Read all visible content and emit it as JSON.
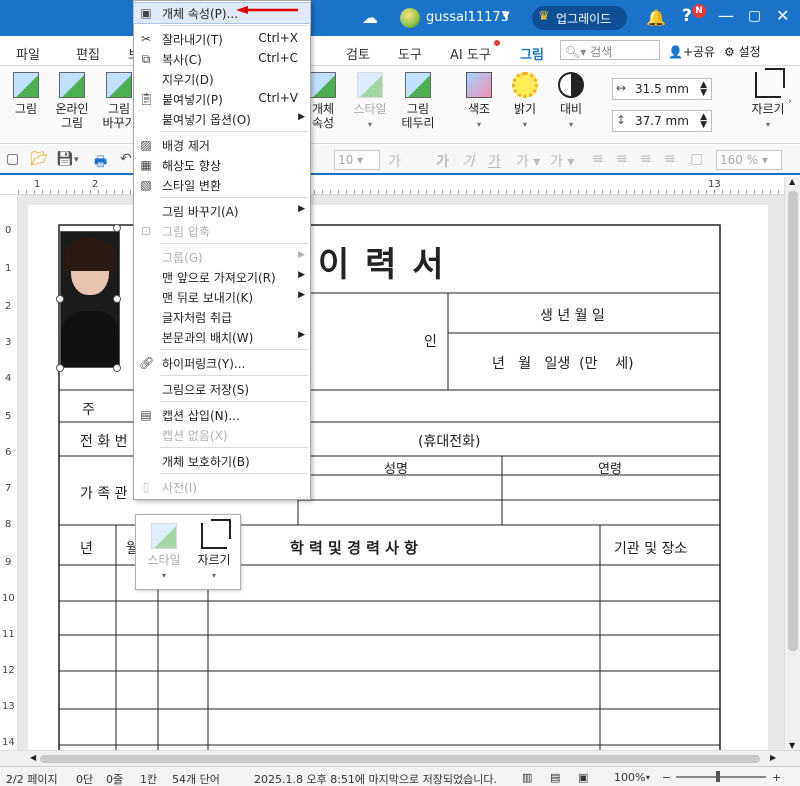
{
  "titlebar": {
    "user": "gussal11173",
    "upgrade_label": "업그레이드",
    "help": "?",
    "badge": "N"
  },
  "tabs": [
    "파일",
    "편집",
    "보",
    "검토",
    "도구",
    "AI 도구",
    "그림"
  ],
  "search": {
    "placeholder": "검색"
  },
  "header_actions": {
    "share": "공유",
    "settings": "설정"
  },
  "ribbon": {
    "picture": "그림",
    "online_picture": "온라인\n그림",
    "replace_picture": "그림\n바꾸기",
    "object_props": "개체\n속성",
    "style": "스타일",
    "picture_border": "그림\n테두리",
    "color": "색조",
    "brightness": "밝기",
    "contrast": "대비",
    "crop": "자르기",
    "width": "31.5 mm",
    "height": "37.7 mm"
  },
  "toolbar2": {
    "font_size": "10",
    "zoom": "160 %",
    "bold_glyph": "가",
    "italic_glyph": "가",
    "under_glyph": "가"
  },
  "ruler": {
    "h": [
      "1",
      "2",
      "13"
    ],
    "v": [
      "0",
      "1",
      "2",
      "3",
      "4",
      "5",
      "6",
      "7",
      "8",
      "9",
      "10",
      "11",
      "12",
      "13",
      "14"
    ]
  },
  "document": {
    "title": "이   력   서",
    "stamp": "인",
    "birthdate_label": "생 년 월 일",
    "age_line": "년   월   일생  (만    세)",
    "address_label": "주",
    "phone_label": "전 화 번",
    "mobile_label": "(휴대전화)",
    "family_label": "가 족 관",
    "name_label": "성명",
    "age_label": "연령",
    "year_label": "년",
    "month_label": "월",
    "edu_label": "학 력 및 경 력 사 항",
    "org_label": "기관 및 장소"
  },
  "context_menu": [
    {
      "label": "개체 속성(P)...",
      "shortcut": "",
      "icon": "picture-props-icon",
      "disabled": false,
      "highlight": true,
      "submenu": false
    },
    {
      "label": "잘라내기(T)",
      "shortcut": "Ctrl+X",
      "icon": "scissors-icon",
      "disabled": false,
      "submenu": false
    },
    {
      "label": "복사(C)",
      "shortcut": "Ctrl+C",
      "icon": "copy-icon",
      "disabled": false,
      "submenu": false
    },
    {
      "label": "지우기(D)",
      "shortcut": "",
      "icon": "",
      "disabled": false,
      "submenu": false
    },
    {
      "label": "붙여넣기(P)",
      "shortcut": "Ctrl+V",
      "icon": "paste-icon",
      "disabled": false,
      "submenu": false
    },
    {
      "label": "붙여넣기 옵션(O)",
      "shortcut": "",
      "icon": "",
      "disabled": false,
      "submenu": true
    },
    {
      "label": "배경 제거",
      "shortcut": "",
      "icon": "remove-bg-icon",
      "disabled": false,
      "submenu": false
    },
    {
      "label": "해상도 향상",
      "shortcut": "",
      "icon": "enhance-icon",
      "disabled": false,
      "submenu": false
    },
    {
      "label": "스타일 변환",
      "shortcut": "",
      "icon": "style-convert-icon",
      "disabled": false,
      "submenu": false
    },
    {
      "label": "그림 바꾸기(A)",
      "shortcut": "",
      "icon": "",
      "disabled": false,
      "submenu": true
    },
    {
      "label": "그림 압축",
      "shortcut": "",
      "icon": "compress-icon",
      "disabled": true,
      "submenu": false
    },
    {
      "label": "그룹(G)",
      "shortcut": "",
      "icon": "",
      "disabled": true,
      "submenu": true
    },
    {
      "label": "맨 앞으로 가져오기(R)",
      "shortcut": "",
      "icon": "",
      "disabled": false,
      "submenu": true
    },
    {
      "label": "맨 뒤로 보내기(K)",
      "shortcut": "",
      "icon": "",
      "disabled": false,
      "submenu": true
    },
    {
      "label": "글자처럼 취급",
      "shortcut": "",
      "icon": "",
      "disabled": false,
      "submenu": false
    },
    {
      "label": "본문과의 배치(W)",
      "shortcut": "",
      "icon": "",
      "disabled": false,
      "submenu": true
    },
    {
      "label": "하이퍼링크(Y)...",
      "shortcut": "",
      "icon": "link-icon",
      "disabled": false,
      "submenu": false
    },
    {
      "label": "그림으로 저장(S)",
      "shortcut": "",
      "icon": "",
      "disabled": false,
      "submenu": false
    },
    {
      "label": "캡션 삽입(N)...",
      "shortcut": "",
      "icon": "caption-icon",
      "disabled": false,
      "submenu": false
    },
    {
      "label": "캡션 없음(X)",
      "shortcut": "",
      "icon": "",
      "disabled": true,
      "submenu": false
    },
    {
      "label": "개체 보호하기(B)",
      "shortcut": "",
      "icon": "",
      "disabled": false,
      "submenu": false
    },
    {
      "label": "사전(I)",
      "shortcut": "",
      "icon": "dictionary-icon",
      "disabled": true,
      "submenu": false
    }
  ],
  "mini_toolbar": {
    "style": "스타일",
    "crop": "자르기"
  },
  "status": {
    "page": "2/2 페이지",
    "para": "0단",
    "line": "0줄",
    "col": "1칸",
    "words": "54개 단어",
    "saved": "2025.1.8 오후 8:51에 마지막으로 저장되었습니다.",
    "zoom": "100%"
  },
  "colors": {
    "accent": "#1a73c8",
    "arrow": "#e00000"
  }
}
